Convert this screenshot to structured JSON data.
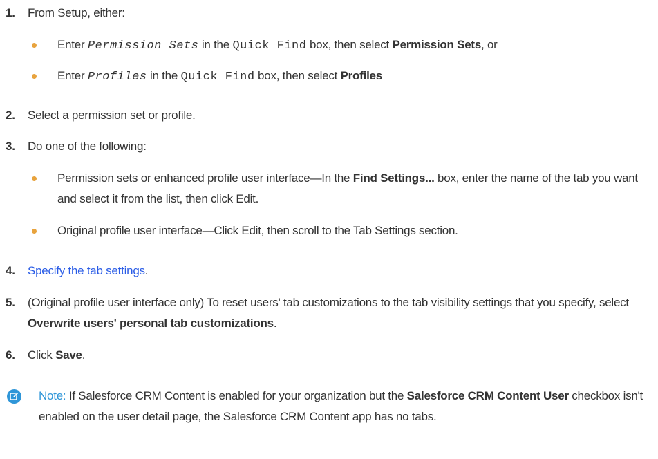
{
  "steps": [
    {
      "number": "1.",
      "text": "From Setup, either:",
      "bullets": [
        {
          "pre": "Enter ",
          "code_italic": "Permission Sets",
          "mid": " in the ",
          "code": "Quick Find",
          "mid2": " box, then select ",
          "bold": "Permission Sets",
          "post": ", or"
        },
        {
          "pre": "Enter ",
          "code_italic": "Profiles",
          "mid": " in the ",
          "code": "Quick Find",
          "mid2": " box, then select ",
          "bold": "Profiles",
          "post": ""
        }
      ]
    },
    {
      "number": "2.",
      "text": "Select a permission set or profile."
    },
    {
      "number": "3.",
      "text": "Do one of the following:",
      "bullets": [
        {
          "pre": "Permission sets or enhanced profile user interface—In the ",
          "bold": "Find Settings...",
          "post": " box, enter the name of the tab you want and select it from the list, then click Edit."
        },
        {
          "text": "Original profile user interface—Click Edit, then scroll to the Tab Settings section."
        }
      ]
    },
    {
      "number": "4.",
      "link": "Specify the tab settings",
      "post": "."
    },
    {
      "number": "5.",
      "pre": "(Original profile user interface only) To reset users' tab customizations to the tab visibility settings that you specify, select ",
      "bold": "Overwrite users' personal tab customizations",
      "post": "."
    },
    {
      "number": "6.",
      "pre": "Click ",
      "bold": "Save",
      "post": "."
    }
  ],
  "note": {
    "icon": "note-edit-icon",
    "label": "Note:",
    "pre": " If Salesforce CRM Content is enabled for your organization but the ",
    "bold": "Salesforce CRM Content User",
    "post": " checkbox isn't enabled on the user detail page, the Salesforce CRM Content app has no tabs."
  },
  "colors": {
    "text": "#333333",
    "bullet": "#e8a33d",
    "link": "#2a5ce6",
    "note_accent": "#2f96d8"
  }
}
